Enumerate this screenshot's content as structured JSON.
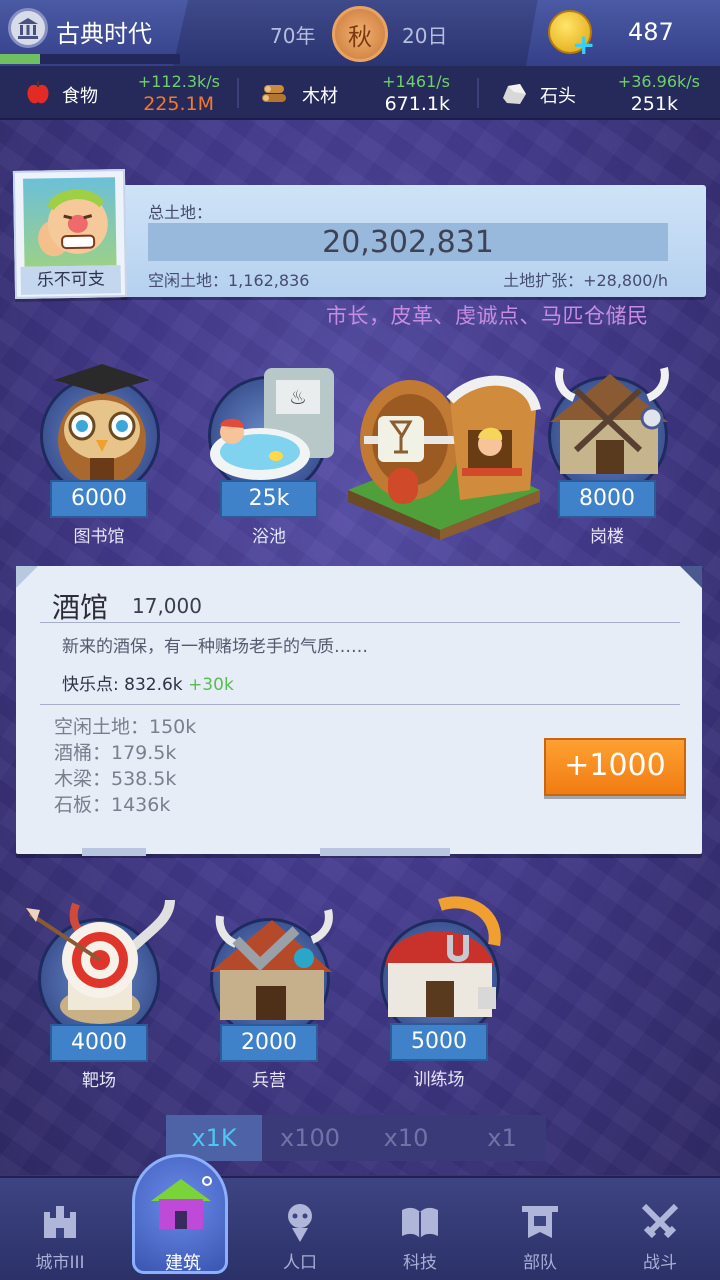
{
  "header": {
    "era_title": "古典时代",
    "era_progress": 0.22,
    "year": "70年",
    "season": "秋",
    "day": "20日",
    "coins": "487"
  },
  "resources": [
    {
      "name": "食物",
      "rate": "+112.3k/s",
      "total": "225.1M",
      "total_color": "#f07a2e",
      "icon": "apple-icon"
    },
    {
      "name": "木材",
      "rate": "+1461/s",
      "total": "671.1k",
      "total_color": "#ffffff",
      "icon": "wood-logs-icon"
    },
    {
      "name": "石头",
      "rate": "+36.96k/s",
      "total": "251k",
      "total_color": "#ffffff",
      "icon": "stone-icon"
    }
  ],
  "land": {
    "label": "总土地：",
    "total": "20,302,831",
    "free": "空闲土地：1,162,836",
    "expansion": "土地扩张：+28,800/h"
  },
  "mayor": {
    "name": "乐不可支"
  },
  "officials": "市长，皮革、虔诚点、马匹仓储民",
  "buildings_top": [
    {
      "name": "图书馆",
      "cost": "6000"
    },
    {
      "name": "浴池",
      "cost": "25k"
    },
    {
      "name": "岗楼",
      "cost": "8000"
    }
  ],
  "tavern": {
    "title": "酒馆",
    "cost": "17,000",
    "desc": "新来的酒保，有一种赌场老手的气质……",
    "joy_label": "快乐点: 832.6k",
    "joy_plus": "+30k",
    "requirements": [
      "空闲土地：150k",
      "酒桶：179.5k",
      "木梁：538.5k",
      "石板：1436k"
    ],
    "button": "+1000"
  },
  "buildings_bottom": [
    {
      "name": "靶场",
      "cost": "4000"
    },
    {
      "name": "兵营",
      "cost": "2000"
    },
    {
      "name": "训练场",
      "cost": "5000"
    }
  ],
  "multipliers": [
    "x1K",
    "x100",
    "x10",
    "x1"
  ],
  "nav": [
    {
      "label": "城市III",
      "icon": "castle-icon"
    },
    {
      "label": "建筑",
      "icon": "house-icon"
    },
    {
      "label": "人口",
      "icon": "person-icon"
    },
    {
      "label": "科技",
      "icon": "book-icon"
    },
    {
      "label": "部队",
      "icon": "banner-icon"
    },
    {
      "label": "战斗",
      "icon": "crossed-swords-icon"
    }
  ]
}
